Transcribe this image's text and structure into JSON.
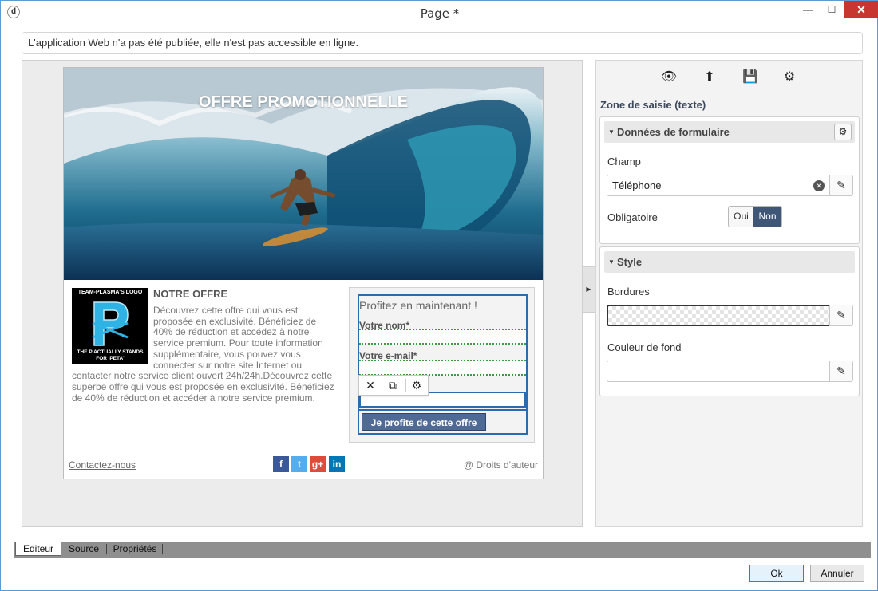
{
  "window": {
    "title": "Page *",
    "app_icon_glyph": "d",
    "minimize_glyph": "—",
    "maximize_glyph": "☐",
    "close_glyph": "✕"
  },
  "notice": "L'application Web n'a pas été publiée, elle n'est pas accessible en ligne.",
  "page": {
    "banner_title": "OFFRE PROMOTIONNELLE",
    "logo_top": "TEAM-PLASMA'S LOGO",
    "logo_bottom": "THE P ACTUALLY STANDS FOR 'PETA'",
    "offer_title": "NOTRE OFFRE",
    "offer_text": "Découvrez cette offre qui vous est proposée en exclusivité. Bénéficiez de 40% de réduction et accédez à notre service premium. Pour toute information supplémentaire, vous pouvez vous connecter sur notre site Internet ou contacter notre service client ouvert 24h/24h.Découvrez cette superbe offre qui vous est proposée en exclusivité. Bénéficiez de 40% de réduction et accéder à notre service premium.",
    "form": {
      "heading": "Profitez en maintenant !",
      "name_label": "Votre nom*",
      "email_label": "Votre e-mail*",
      "partial_label": "e",
      "submit_label": "Je profite de cette offre"
    },
    "contact_link": "Contactez-nous",
    "social": [
      {
        "name": "facebook-icon",
        "glyph": "f",
        "color": "#3b5998"
      },
      {
        "name": "twitter-icon",
        "glyph": "t",
        "color": "#55acee"
      },
      {
        "name": "google-plus-icon",
        "glyph": "g+",
        "color": "#dd4b39"
      },
      {
        "name": "linkedin-icon",
        "glyph": "in",
        "color": "#0077b5"
      }
    ],
    "copyright": "@ Droits d'auteur"
  },
  "context_toolbar": {
    "delete_glyph": "✕",
    "copy_glyph": "⧉",
    "settings_glyph": "⚙"
  },
  "collapse_glyph": "▶",
  "properties": {
    "toolbar_glyphs": {
      "preview": "👁",
      "export": "⬆",
      "save": "💾",
      "settings": "⚙"
    },
    "heading": "Zone de saisie (texte)",
    "form_section": {
      "title": "Données de formulaire",
      "caret": "▼",
      "settings_glyph": "⚙",
      "field_label": "Champ",
      "field_value": "Téléphone",
      "clear_glyph": "✕",
      "edit_glyph": "✎",
      "required_label": "Obligatoire",
      "toggle_yes": "Oui",
      "toggle_no": "Non",
      "required": false
    },
    "style_section": {
      "title": "Style",
      "caret": "▼",
      "borders_label": "Bordures",
      "background_label": "Couleur de fond",
      "edit_glyph": "✎"
    }
  },
  "tabs": [
    {
      "label": "Editeur",
      "active": true
    },
    {
      "label": "Source",
      "active": false
    },
    {
      "label": "Propriétés",
      "active": false
    }
  ],
  "buttons": {
    "ok": "Ok",
    "cancel": "Annuler"
  },
  "colors": {
    "accent": "#2b6cb0",
    "toggle_on": "#3f5677",
    "submit_bg": "#4f6a94",
    "close_red": "#c7372f"
  }
}
